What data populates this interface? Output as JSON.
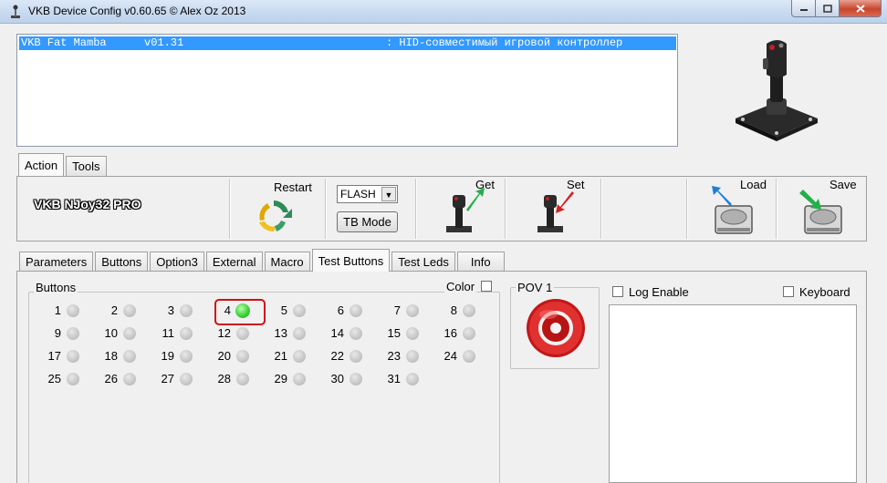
{
  "window": {
    "title": "VKB Device Config v0.60.65 © Alex Oz 2013"
  },
  "device_list": {
    "rows": [
      {
        "name": "VKB Fat Mamba",
        "version": "v01.31",
        "description": ": HID-совместимый игровой контроллер"
      }
    ]
  },
  "top_tabs": [
    "Action",
    "Tools"
  ],
  "action": {
    "device_name": "VKB NJoy32 PRO",
    "restart_label": "Restart",
    "mode_select_value": "FLASH",
    "tb_mode_label": "TB Mode",
    "get_label": "Get",
    "set_label": "Set",
    "load_label": "Load",
    "save_label": "Save"
  },
  "bottom_tabs": [
    "Parameters",
    "Buttons",
    "Option3",
    "External",
    "Macro",
    "Test Buttons",
    "Test Leds",
    "Info"
  ],
  "test_buttons": {
    "group_label": "Buttons",
    "color_label": "Color",
    "buttons": [
      "1",
      "2",
      "3",
      "4",
      "5",
      "6",
      "7",
      "8",
      "9",
      "10",
      "11",
      "12",
      "13",
      "14",
      "15",
      "16",
      "17",
      "18",
      "19",
      "20",
      "21",
      "22",
      "23",
      "24",
      "25",
      "26",
      "27",
      "28",
      "29",
      "30",
      "31"
    ],
    "pressed": "4",
    "pov_label": "POV 1",
    "log_enable_label": "Log Enable",
    "keyboard_label": "Keyboard"
  },
  "colors": {
    "selection": "#3399ff",
    "led_on": "#3fd23a",
    "pov_red": "#d42020",
    "highlight": "#d01010"
  }
}
